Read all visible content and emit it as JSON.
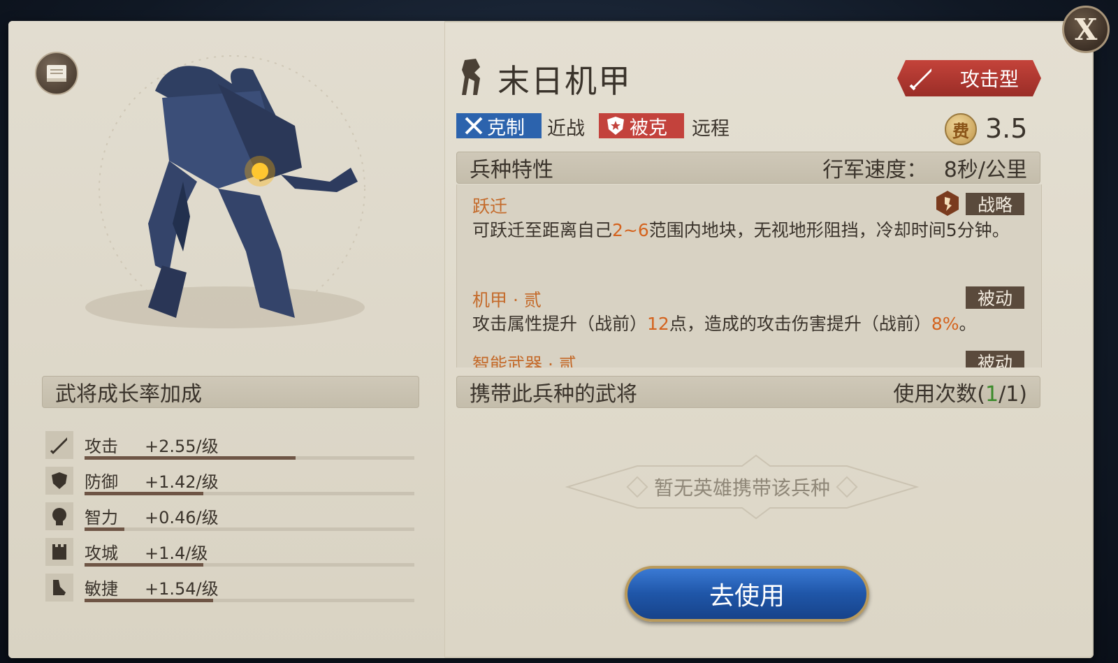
{
  "close_label": "X",
  "unit": {
    "name": "末日机甲",
    "type_label": "攻击型",
    "counter_label": "克制",
    "counter_target": "近战",
    "countered_label": "被克",
    "countered_target": "远程",
    "cost_symbol": "费",
    "cost": "3.5"
  },
  "growth": {
    "title": "武将成长率加成",
    "stats": [
      {
        "name": "攻击",
        "value": "+2.55/级",
        "icon": "sword-icon",
        "fill": 0.64
      },
      {
        "name": "防御",
        "value": "+1.42/级",
        "icon": "shield-icon",
        "fill": 0.36
      },
      {
        "name": "智力",
        "value": "+0.46/级",
        "icon": "head-icon",
        "fill": 0.12
      },
      {
        "name": "攻城",
        "value": "+1.4/级",
        "icon": "tower-icon",
        "fill": 0.36
      },
      {
        "name": "敏捷",
        "value": "+1.54/级",
        "icon": "boot-icon",
        "fill": 0.39
      }
    ]
  },
  "traits": {
    "title": "兵种特性",
    "march_label": "行军速度：",
    "march_value": "8秒/公里",
    "items": [
      {
        "name": "跃迁",
        "tag": "战略",
        "desc_pre": "可跃迁至距离自己",
        "desc_hl": "2~6",
        "desc_post": "范围内地块，无视地形阻挡，冷却时间5分钟。"
      },
      {
        "name": "机甲 · 贰",
        "tag": "被动",
        "desc_pre": "攻击属性提升（战前）",
        "desc_hl": "12",
        "desc_mid": "点，造成的攻击伤害提升（战前）",
        "desc_hl2": "8%",
        "desc_post": "。"
      },
      {
        "name": "智能武器 · 贰",
        "tag": "被动"
      }
    ]
  },
  "carriers": {
    "title": "携带此兵种的武将",
    "uses_label": "使用次数(",
    "uses_current": "1",
    "uses_total": "/1)",
    "empty_text": "暂无英雄携带该兵种"
  },
  "use_button": "去使用"
}
